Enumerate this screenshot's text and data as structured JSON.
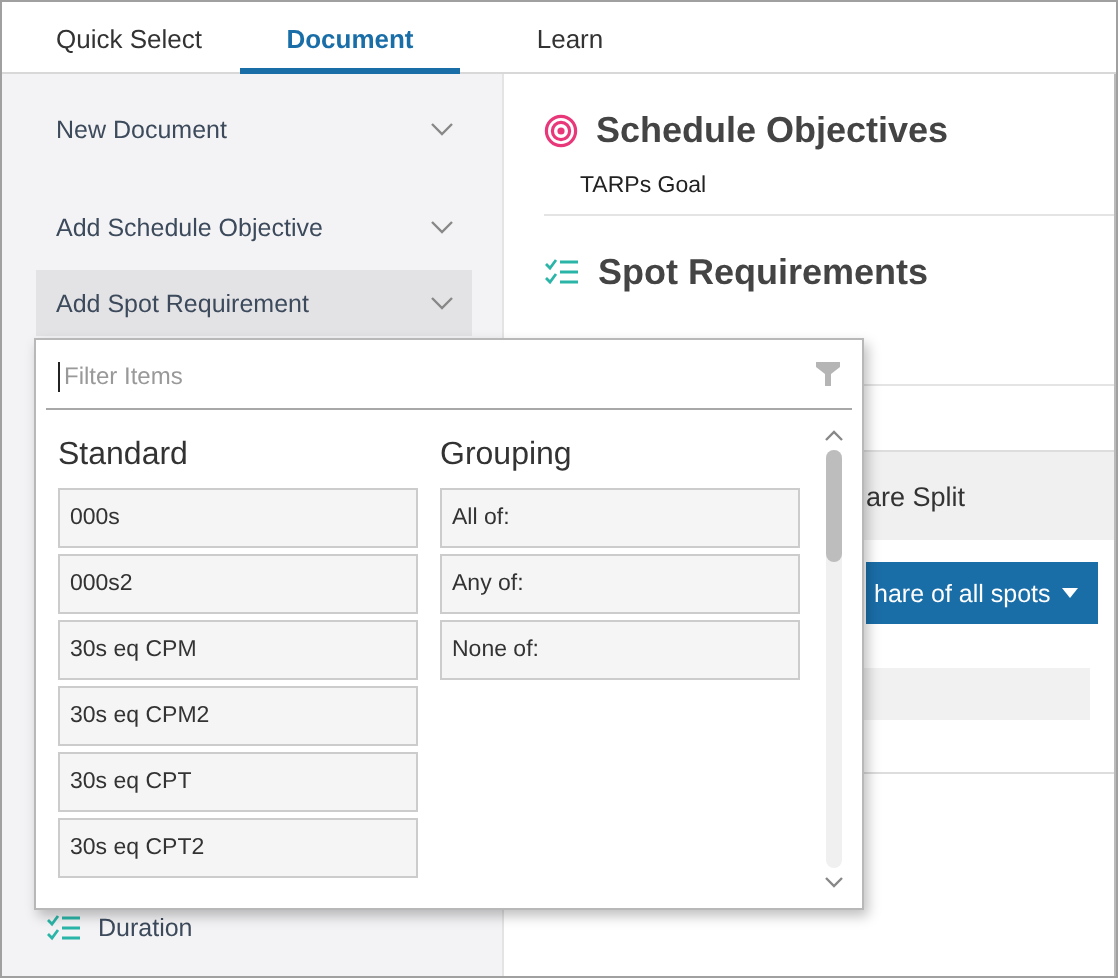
{
  "tabs": [
    {
      "label": "Quick Select",
      "selected": false
    },
    {
      "label": "Document",
      "selected": true
    },
    {
      "label": "Learn",
      "selected": false
    }
  ],
  "sidebar": {
    "items": [
      {
        "label": "New Document",
        "selected": false
      },
      {
        "label": "Add Schedule Objective",
        "selected": false
      },
      {
        "label": "Add Spot Requirement",
        "selected": true
      }
    ],
    "footer_item": "Duration"
  },
  "main": {
    "sections": [
      {
        "kind": "objectives",
        "title": "Schedule Objectives",
        "rows": [
          "TARPs Goal"
        ]
      },
      {
        "kind": "requirements",
        "title": "Spot Requirements"
      }
    ],
    "card": {
      "header": "are Split",
      "button": "hare of all spots"
    }
  },
  "popup": {
    "filter": {
      "placeholder": "Filter Items"
    },
    "columns": [
      {
        "heading": "Standard",
        "items": [
          "000s",
          "000s2",
          "30s eq CPM",
          "30s eq CPM2",
          "30s eq CPT",
          "30s eq CPT2"
        ]
      },
      {
        "heading": "Grouping",
        "items": [
          "All of:",
          "Any of:",
          "None of:"
        ]
      }
    ]
  }
}
